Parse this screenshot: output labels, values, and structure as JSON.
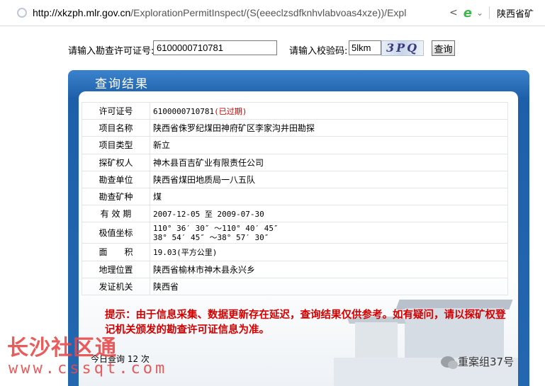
{
  "browser": {
    "url_host": "http://xkzph.mlr.gov.cn",
    "url_rest": "/ExplorationPermitInspect/(S(eeeclzsdfknhvlabvoas4xze))/Expl",
    "tab_title": "陕西省矿"
  },
  "form": {
    "permit_label": "请输入勘查许可证号:",
    "permit_value": "6100000710781",
    "captcha_label": "请输入校验码:",
    "captcha_value": "5lkm",
    "captcha_image_text": "3PQ",
    "search_button": "查询"
  },
  "panel": {
    "title": "查询结果",
    "rows": [
      {
        "key": "许可证号",
        "value": "6100000710781",
        "status": "(已过期)"
      },
      {
        "key": "项目名称",
        "value": "陕西省侏罗纪煤田神府矿区李家沟井田勘探"
      },
      {
        "key": "项目类型",
        "value": "新立"
      },
      {
        "key": "探矿权人",
        "value": "神木县百吉矿业有限责任公司"
      },
      {
        "key": "勘查单位",
        "value": "陕西省煤田地质局一八五队"
      },
      {
        "key": "勘查矿种",
        "value": "煤"
      },
      {
        "key": "有 效 期",
        "value_start": "2007-12-05",
        "value_to": "至",
        "value_end": "2009-07-30"
      },
      {
        "key": "极值坐标",
        "line1": "110° 36′ 30″ ～110° 40′ 45″",
        "line2": "38° 54′ 45″ ～38° 57′ 30″"
      },
      {
        "key": "面　　积",
        "value": "19.03(平方公里)"
      },
      {
        "key": "地理位置",
        "value": "陕西省榆林市神木县永兴乡"
      },
      {
        "key": "发证机关",
        "value": "陕西省"
      }
    ],
    "notice": "提示：由于信息采集、数据更新存在延迟，查询结果仅供参考。如有疑问，请以探矿权登记机关颁发的勘查许可证信息为准。",
    "visits": "今日查询 12 次"
  },
  "watermarks": {
    "site_name": "长沙社区通",
    "site_url": "www.cssqt.com",
    "wechat": "重案组37号"
  }
}
